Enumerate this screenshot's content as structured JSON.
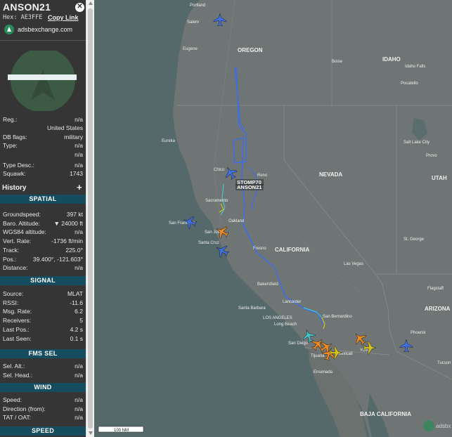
{
  "aircraft": {
    "callsign": "ANSON21",
    "hex_label": "Hex:",
    "hex": "AE3FFE",
    "copy_link": "Copy Link",
    "source_link": "adsbexchange.com"
  },
  "info": [
    {
      "key": "Reg.:",
      "value": "n/a"
    },
    {
      "key": "",
      "value": "United States"
    },
    {
      "key": "DB flags:",
      "value": "military"
    },
    {
      "key": "Type:",
      "value": "n/a"
    },
    {
      "key": "",
      "value": "n/a"
    },
    {
      "key": "Type Desc.:",
      "value": "n/a"
    },
    {
      "key": "Squawk:",
      "value": "1743"
    }
  ],
  "history_label": "History",
  "spatial": {
    "title": "SPATIAL",
    "rows": [
      {
        "key": "Groundspeed:",
        "value": "397 kt"
      },
      {
        "key": "Baro. Altitude:",
        "value": "▼ 24000 ft"
      },
      {
        "key": "WGS84 altitude:",
        "value": "n/a"
      },
      {
        "key": "Vert. Rate:",
        "value": "-1736 ft/min"
      },
      {
        "key": "Track:",
        "value": "225.0°"
      },
      {
        "key": "Pos.:",
        "value": "39.400°, -121.603°"
      },
      {
        "key": "Distance:",
        "value": "n/a"
      }
    ]
  },
  "signal": {
    "title": "SIGNAL",
    "rows": [
      {
        "key": "Source:",
        "value": "MLAT"
      },
      {
        "key": "RSSI:",
        "value": "-11.6"
      },
      {
        "key": "Msg. Rate:",
        "value": "6.2"
      },
      {
        "key": "Receivers:",
        "value": "5"
      },
      {
        "key": "Last Pos.:",
        "value": "4.2 s"
      },
      {
        "key": "Last Seen:",
        "value": "0.1 s"
      }
    ]
  },
  "fms": {
    "title": "FMS SEL",
    "rows": [
      {
        "key": "Sel. Alt.:",
        "value": "n/a"
      },
      {
        "key": "Sel. Head.:",
        "value": "n/a"
      }
    ]
  },
  "wind": {
    "title": "WIND",
    "rows": [
      {
        "key": "Speed:",
        "value": "n/a"
      },
      {
        "key": "Direction (from):",
        "value": "n/a"
      },
      {
        "key": "TAT / OAT:",
        "value": "n/a"
      }
    ]
  },
  "speed": {
    "title": "SPEED"
  },
  "map": {
    "states": [
      "OREGON",
      "IDAHO",
      "NEVADA",
      "UTAH",
      "CALIFORNIA",
      "ARIZONA",
      "BAJA CALIFORNIA"
    ],
    "cities": [
      "Portland",
      "Salem",
      "Eugene",
      "Boise",
      "Idaho Falls",
      "Pocatello",
      "Salt Lake City",
      "Provo",
      "Eureka",
      "Chico",
      "Reno",
      "Sacramento",
      "Oakland",
      "San Francisco",
      "San Jose",
      "Santa Cruz",
      "Fresno",
      "St. George",
      "Las Vegas",
      "Flagstaff",
      "Bakersfield",
      "Lancaster",
      "Santa Barbara",
      "LOS ANGELES",
      "Long Beach",
      "San Bernardino",
      "Phoenix",
      "Tucson",
      "San Diego",
      "Tijuana",
      "Mexicali",
      "Yuma",
      "Ensenada"
    ],
    "callouts": [
      "STOMP70",
      "ANSON21"
    ],
    "scale_label": "100 NM",
    "watermark": "adsbx",
    "colors": {
      "track_high": "#3b6df0",
      "track_mid": "#46c3c8",
      "track_low": "#d4c21a",
      "military_plane": "#f08a1f",
      "selected_plane": "#3e6fe6"
    }
  }
}
